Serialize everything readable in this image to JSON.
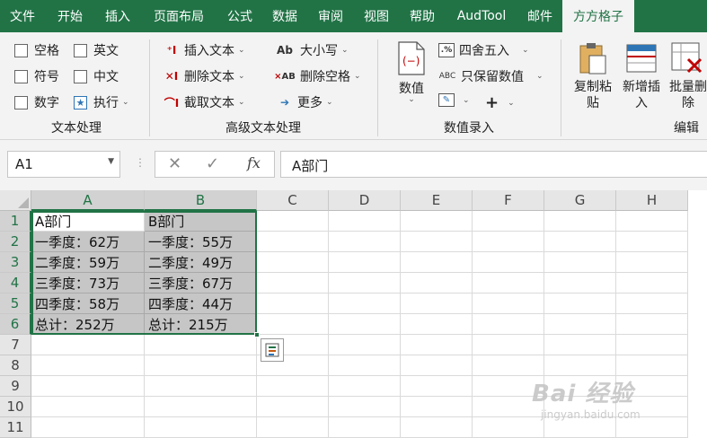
{
  "menu": {
    "tabs": [
      {
        "label": "文件",
        "w": 50
      },
      {
        "label": "开始",
        "w": 56
      },
      {
        "label": "插入",
        "w": 50
      },
      {
        "label": "页面布局",
        "w": 86
      },
      {
        "label": "公式",
        "w": 50
      },
      {
        "label": "数据",
        "w": 50
      },
      {
        "label": "审阅",
        "w": 52
      },
      {
        "label": "视图",
        "w": 50
      },
      {
        "label": "帮助",
        "w": 52
      },
      {
        "label": "AudTool",
        "w": 80
      },
      {
        "label": "邮件",
        "w": 50
      },
      {
        "label": "方方格子",
        "w": 80
      }
    ],
    "active_index": 11
  },
  "ribbon": {
    "text_processing": {
      "space": "空格",
      "english": "英文",
      "symbol": "符号",
      "chinese": "中文",
      "number": "数字",
      "execute": "执行",
      "group": "文本处理"
    },
    "advanced": {
      "insert_text": "插入文本",
      "delete_text": "删除文本",
      "truncate_text": "截取文本",
      "case": "大小写",
      "delete_space": "删除空格",
      "more": "更多",
      "group": "高级文本处理"
    },
    "numeric": {
      "value": "数值",
      "round": "四舍五入",
      "keep_value": "只保留数值",
      "group": "数值录入"
    },
    "edit": {
      "copy_paste": "复制粘贴",
      "add_insert": "新增插入",
      "batch_delete": "批量删除",
      "group": "编辑"
    }
  },
  "formula_bar": {
    "name_box": "A1",
    "content": "A部门"
  },
  "grid": {
    "columns": [
      "A",
      "B",
      "C",
      "D",
      "E",
      "F",
      "G",
      "H"
    ],
    "rows": [
      "1",
      "2",
      "3",
      "4",
      "5",
      "6",
      "7",
      "8",
      "9",
      "10",
      "11"
    ],
    "cells": [
      [
        "A部门",
        "B部门"
      ],
      [
        "一季度：62万",
        "一季度：55万"
      ],
      [
        "二季度：59万",
        "二季度：49万"
      ],
      [
        "三季度：73万",
        "三季度：67万"
      ],
      [
        "四季度：58万",
        "四季度：44万"
      ],
      [
        "总计：252万",
        "总计：215万"
      ]
    ]
  },
  "watermark": {
    "line1": "Bai 经验",
    "line2": "jingyan.baidu.com"
  }
}
